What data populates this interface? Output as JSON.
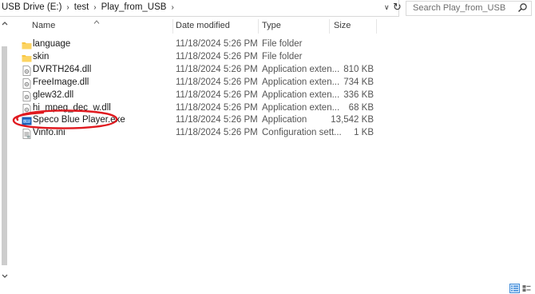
{
  "address": {
    "crumbs": [
      "USB Drive (E:)",
      "test",
      "Play_from_USB"
    ]
  },
  "search": {
    "placeholder": "Search Play_from_USB"
  },
  "columns": {
    "name": "Name",
    "date": "Date modified",
    "type": "Type",
    "size": "Size"
  },
  "files": [
    {
      "name": "language",
      "date": "11/18/2024 5:26 PM",
      "type": "File folder",
      "size": "",
      "icon": "folder-icon"
    },
    {
      "name": "skin",
      "date": "11/18/2024 5:26 PM",
      "type": "File folder",
      "size": "",
      "icon": "folder-icon"
    },
    {
      "name": "DVRTH264.dll",
      "date": "11/18/2024 5:26 PM",
      "type": "Application exten...",
      "size": "810 KB",
      "icon": "dll-file-icon"
    },
    {
      "name": "FreeImage.dll",
      "date": "11/18/2024 5:26 PM",
      "type": "Application exten...",
      "size": "734 KB",
      "icon": "dll-file-icon"
    },
    {
      "name": "glew32.dll",
      "date": "11/18/2024 5:26 PM",
      "type": "Application exten...",
      "size": "336 KB",
      "icon": "dll-file-icon"
    },
    {
      "name": "hi_mpeg_dec_w.dll",
      "date": "11/18/2024 5:26 PM",
      "type": "Application exten...",
      "size": "68 KB",
      "icon": "dll-file-icon"
    },
    {
      "name": "Speco Blue Player.exe",
      "date": "11/18/2024 5:26 PM",
      "type": "Application",
      "size": "13,542 KB",
      "icon": "exe-app-icon"
    },
    {
      "name": "Vinfo.ini",
      "date": "11/18/2024 5:26 PM",
      "type": "Configuration sett...",
      "size": "1 KB",
      "icon": "ini-file-icon"
    }
  ],
  "colors": {
    "folder": "#f8c33b",
    "annotation": "#e0191f",
    "exe": "#1c5fb6",
    "accent": "#3f8bd8"
  }
}
